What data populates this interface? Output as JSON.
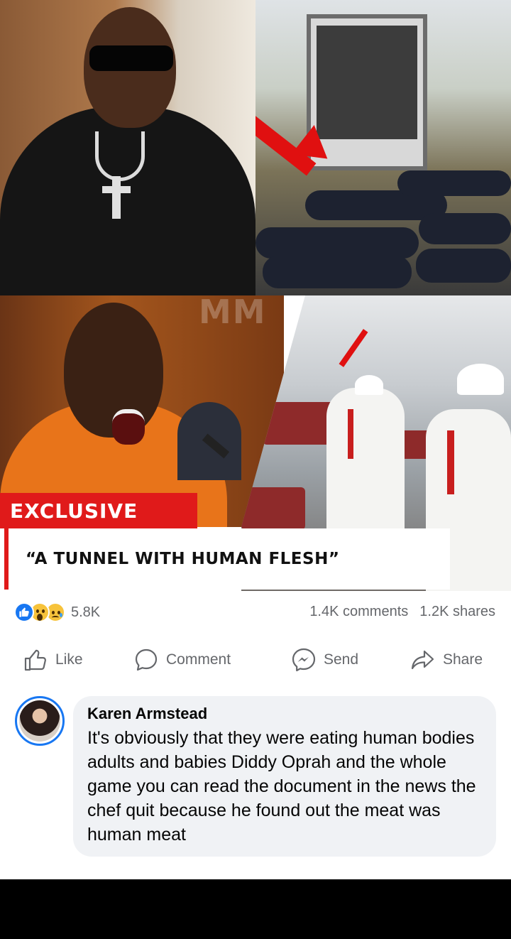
{
  "post": {
    "watermark": "MM",
    "badge": "EXCLUSIVE",
    "headline": "“A TUNNEL WITH HUMAN FLESH”"
  },
  "stats": {
    "reaction_count": "5.8K",
    "comments": "1.4K comments",
    "shares": "1.2K shares",
    "reactions": [
      "like",
      "wow",
      "sad"
    ]
  },
  "actions": {
    "like": "Like",
    "comment": "Comment",
    "send": "Send",
    "share": "Share"
  },
  "comment": {
    "author": "Karen Armstead",
    "text": "It's obviously that they were eating human bodies adults and babies Diddy Oprah and the whole game you can read the document in the news the chef quit because he found out the meat was human meat"
  },
  "colors": {
    "accent": "#1877f2",
    "exclusive_red": "#e01a1a",
    "muted_text": "#65676b",
    "bubble_bg": "#f0f2f5"
  }
}
